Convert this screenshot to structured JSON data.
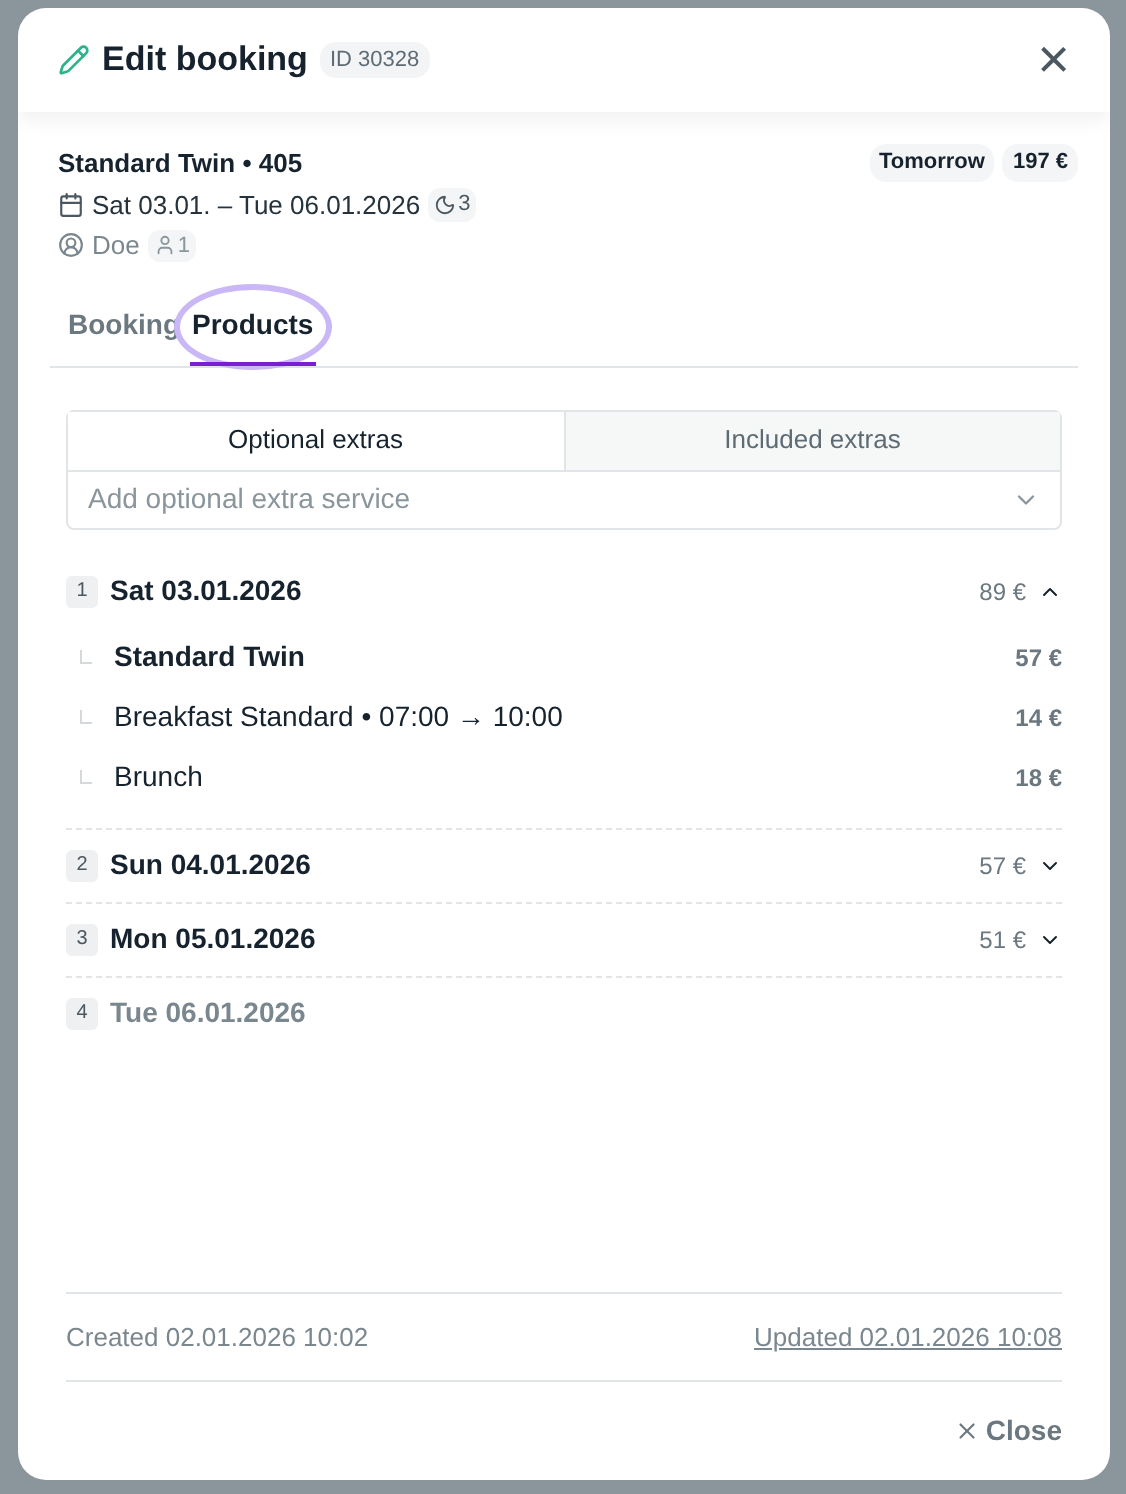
{
  "dialog": {
    "title": "Edit booking",
    "id_badge": "ID 30328",
    "close_label": "×"
  },
  "summary": {
    "room": "Standard Twin • 405",
    "dates": "Sat 03.01. – Tue 06.01.2026",
    "nights": "3",
    "guest": "Doe",
    "persons": "1",
    "badges": [
      "Tomorrow",
      "197 €"
    ]
  },
  "tabs": [
    {
      "label": "Booking",
      "selected": false,
      "highlighted": false
    },
    {
      "label": "Products",
      "selected": true,
      "highlighted": true
    }
  ],
  "extras_tabs": [
    {
      "label": "Optional extras",
      "selected": true
    },
    {
      "label": "Included extras",
      "selected": false
    }
  ],
  "extra_select": {
    "placeholder": "Add optional extra service"
  },
  "days": [
    {
      "index": "1",
      "date": "Sat 03.01.2026",
      "price": "89 €",
      "expanded": true,
      "disabled": false,
      "children": [
        {
          "kind": "room",
          "name": "Standard Twin",
          "price": "57 €"
        },
        {
          "kind": "extra",
          "name": "Breakfast Standard • 07:00 → 10:00",
          "price": "14 €"
        },
        {
          "kind": "extra",
          "name": "Brunch",
          "price": "18 €"
        }
      ]
    },
    {
      "index": "2",
      "date": "Sun 04.01.2026",
      "price": "57 €",
      "expanded": false,
      "disabled": false
    },
    {
      "index": "3",
      "date": "Mon 05.01.2026",
      "price": "51 €",
      "expanded": false,
      "disabled": false
    },
    {
      "index": "4",
      "date": "Tue 06.01.2026",
      "expanded": false,
      "disabled": true
    }
  ],
  "footer": {
    "created": "Created 02.01.2026 10:02",
    "updated": "Updated 02.01.2026 10:08",
    "close_button": "Close"
  }
}
